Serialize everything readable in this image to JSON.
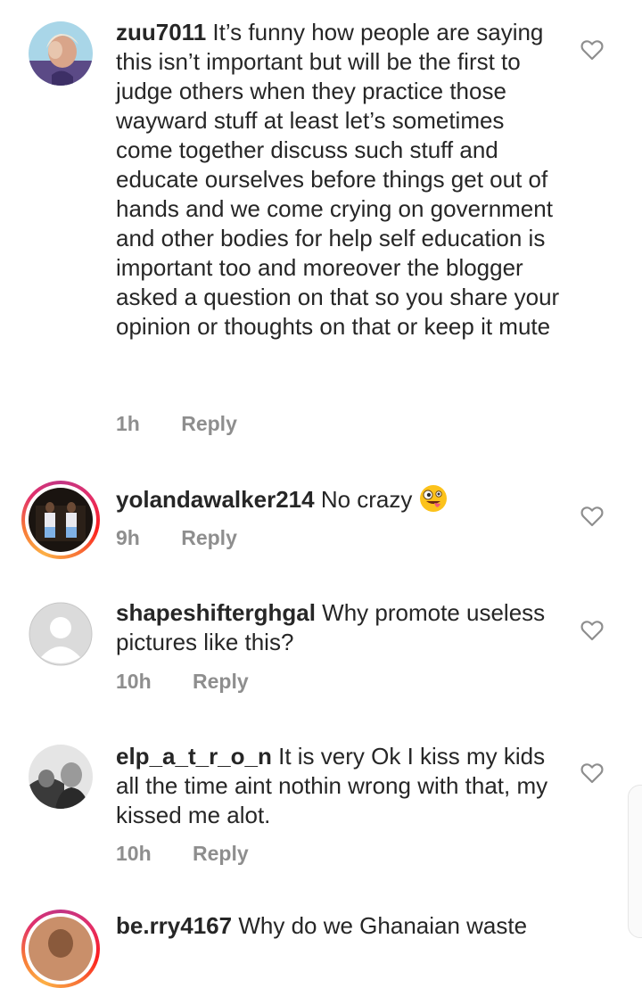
{
  "comments": [
    {
      "username": "zuu7011",
      "text": "It’s funny how people are saying this isn’t important but will be the first to judge others when they practice those wayward stuff at least let’s sometimes come together discuss such stuff and educate ourselves before things get out of hands and we come crying on government and other bodies for help self education is important too and moreover the blogger asked a question on that so you share your opinion or thoughts on that or keep it mute",
      "time": "1h",
      "reply_label": "Reply",
      "avatar": "user-photo-avatar"
    },
    {
      "username": "yolandawalker214",
      "text": "No crazy",
      "emoji": "zany-face-emoji",
      "time": "9h",
      "reply_label": "Reply",
      "avatar": "story-ring-avatar"
    },
    {
      "username": "shapeshifterghgal",
      "text": "Why promote useless pictures like this?",
      "time": "10h",
      "reply_label": "Reply",
      "avatar": "default-avatar"
    },
    {
      "username": "elp_a_t_r_o_n",
      "text": "It is very Ok I kiss my kids all the time aint nothin wrong with that, my kissed me alot.",
      "time": "10h",
      "reply_label": "Reply",
      "avatar": "user-photo-avatar"
    },
    {
      "username": "be.rry4167",
      "text": "Why do we Ghanaian waste",
      "avatar": "story-ring-avatar"
    }
  ],
  "icons": {
    "like": "heart-outline-icon"
  },
  "colors": {
    "text": "#262626",
    "meta": "#8e8e8e",
    "story_ring": "#e1306c"
  }
}
